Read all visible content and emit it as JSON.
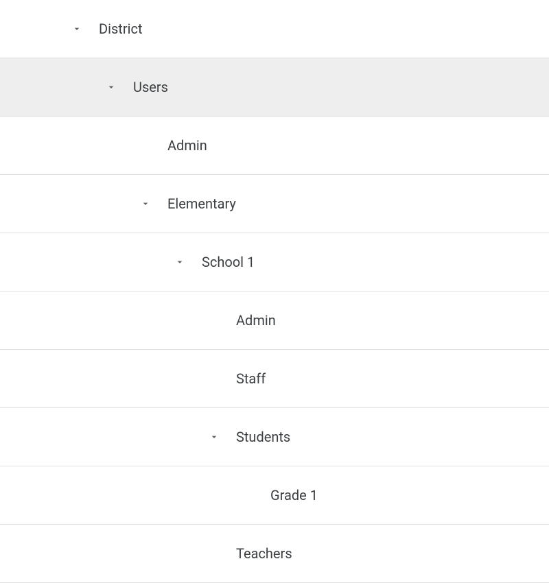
{
  "tree": {
    "row0": {
      "label": "District",
      "expanded": true,
      "indent": 0,
      "selected": false,
      "hasChildren": true
    },
    "row1": {
      "label": "Users",
      "expanded": true,
      "indent": 1,
      "selected": true,
      "hasChildren": true
    },
    "row2": {
      "label": "Admin",
      "expanded": false,
      "indent": 2,
      "selected": false,
      "hasChildren": false
    },
    "row3": {
      "label": "Elementary",
      "expanded": true,
      "indent": 2,
      "selected": false,
      "hasChildren": true
    },
    "row4": {
      "label": "School 1",
      "expanded": true,
      "indent": 3,
      "selected": false,
      "hasChildren": true
    },
    "row5": {
      "label": "Admin",
      "expanded": false,
      "indent": 4,
      "selected": false,
      "hasChildren": false
    },
    "row6": {
      "label": "Staff",
      "expanded": false,
      "indent": 4,
      "selected": false,
      "hasChildren": false
    },
    "row7": {
      "label": "Students",
      "expanded": true,
      "indent": 4,
      "selected": false,
      "hasChildren": true
    },
    "row8": {
      "label": "Grade 1",
      "expanded": false,
      "indent": 5,
      "selected": false,
      "hasChildren": false
    },
    "row9": {
      "label": "Teachers",
      "expanded": false,
      "indent": 4,
      "selected": false,
      "hasChildren": false
    }
  }
}
